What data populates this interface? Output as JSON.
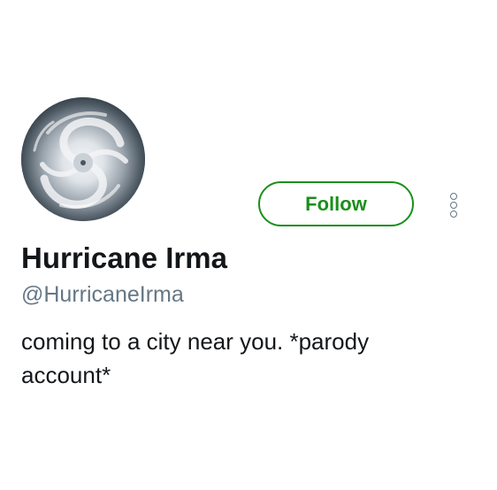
{
  "profile": {
    "display_name": "Hurricane Irma",
    "handle": "@HurricaneIrma",
    "bio": "coming to a city near you. *parody account*",
    "avatar_description": "hurricane-satellite-image"
  },
  "actions": {
    "follow_label": "Follow",
    "more_icon": "more-vertical-icon"
  },
  "colors": {
    "follow_accent": "#1a8f1a",
    "handle_text": "#657786",
    "primary_text": "#14171a",
    "background": "#ffffff"
  }
}
